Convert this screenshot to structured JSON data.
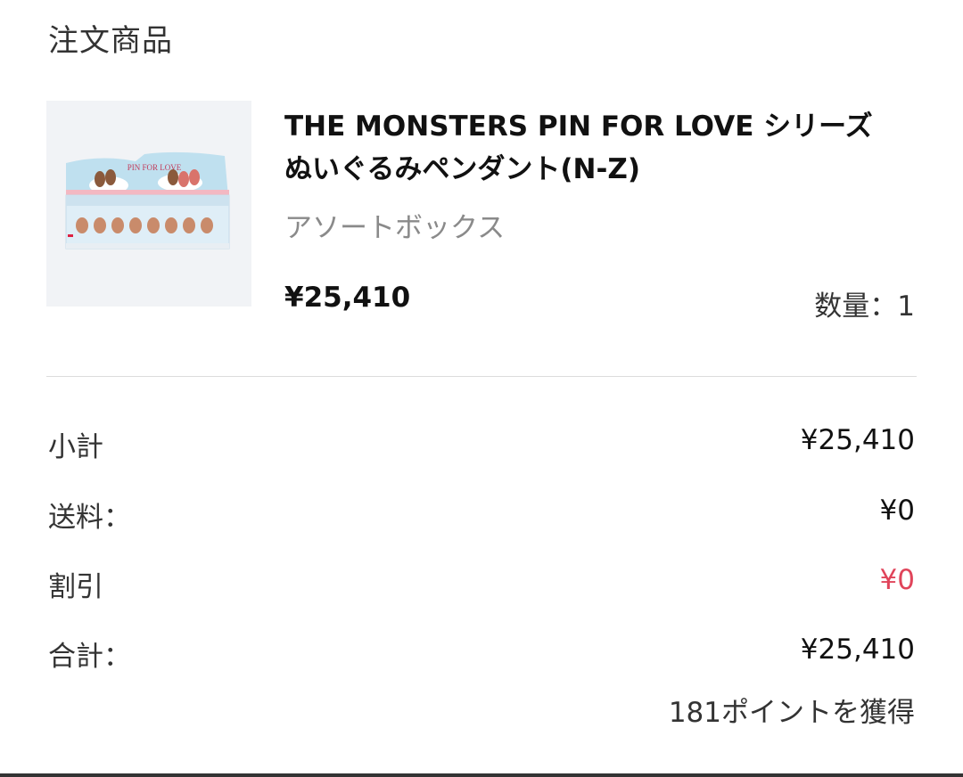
{
  "section_title": "注文商品",
  "product": {
    "name_line1": "THE MONSTERS PIN FOR LOVE シリーズ",
    "name_line2": "ぬいぐるみペンダント(N-Z)",
    "variant": "アソートボックス",
    "price": "¥25,410",
    "quantity": "数量：1",
    "image_text": "PIN FOR LOVE"
  },
  "summary": {
    "subtotal_label": "小計",
    "subtotal_value": "¥25,410",
    "shipping_label": "送料：",
    "shipping_value": "¥0",
    "discount_label": "割引",
    "discount_value": "¥0",
    "total_label": "合計：",
    "total_value": "¥25,410",
    "points": "181ポイントを獲得"
  },
  "colors": {
    "discount": "#e0445a"
  }
}
